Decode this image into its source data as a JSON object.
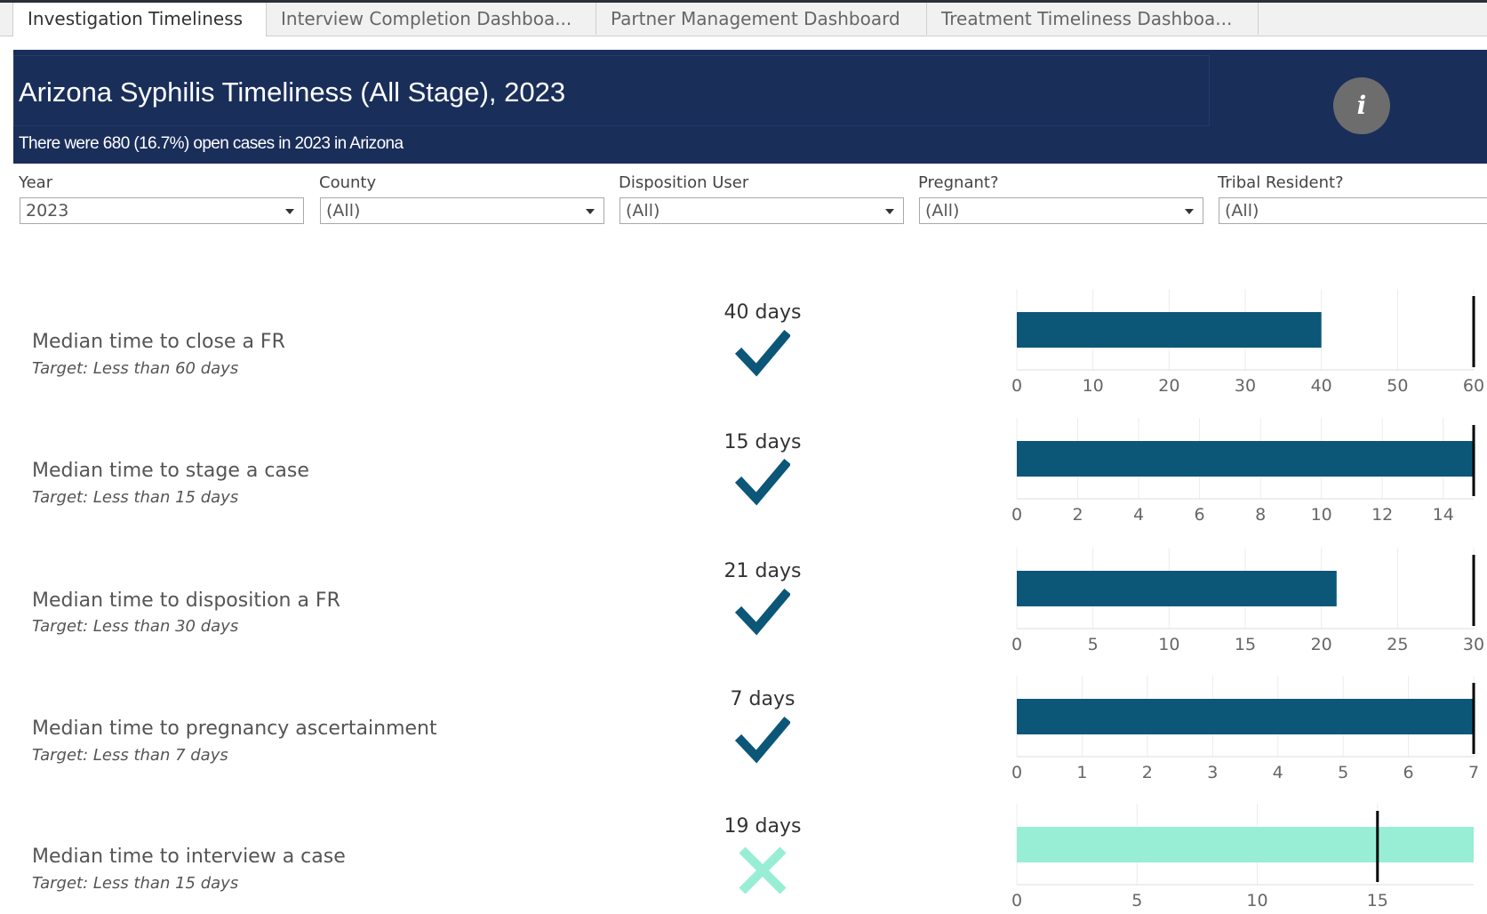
{
  "tabs": [
    {
      "label": "Investigation Timeliness",
      "active": true
    },
    {
      "label": "Interview Completion Dashboa...",
      "active": false
    },
    {
      "label": "Partner Management Dashboard",
      "active": false
    },
    {
      "label": "Treatment Timeliness Dashboa...",
      "active": false
    }
  ],
  "header": {
    "title": "Arizona Syphilis Timeliness (All Stage),  2023",
    "subtitle": "There were 680 (16.7%) open cases in 2023 in Arizona",
    "info_icon": "i",
    "background": "#1a2e5a"
  },
  "filters": [
    {
      "label": "Year",
      "value": "2023"
    },
    {
      "label": "County",
      "value": "(All)"
    },
    {
      "label": "Disposition User",
      "value": "(All)"
    },
    {
      "label": "Pregnant?",
      "value": "(All)"
    },
    {
      "label": "Tribal Resident?",
      "value": "(All)"
    }
  ],
  "colors": {
    "met": "#0c5678",
    "not_met": "#98eed4",
    "target_line": "#000000",
    "axis_text": "#666666"
  },
  "metrics": [
    {
      "label": "Median time to close a FR",
      "target_text": "Target: Less than 60 days",
      "value_text": "40 days",
      "status_icon": "check-icon"
    },
    {
      "label": "Median time to stage a case",
      "target_text": "Target: Less than 15 days",
      "value_text": "15 days",
      "status_icon": "check-icon"
    },
    {
      "label": "Median time to disposition a FR",
      "target_text": "Target: Less than 30 days",
      "value_text": "21 days",
      "status_icon": "check-icon"
    },
    {
      "label": "Median time to pregnancy ascertainment",
      "target_text": "Target: Less than 7 days",
      "value_text": "7 days",
      "status_icon": "check-icon"
    },
    {
      "label": "Median time to interview a case",
      "target_text": "Target: Less than 15 days",
      "value_text": "19 days",
      "status_icon": "x-icon"
    }
  ],
  "chart_data": [
    {
      "type": "bar",
      "title": "",
      "series": [
        {
          "values": [
            40
          ]
        }
      ],
      "target": 60,
      "xlim": [
        0,
        60
      ],
      "ticks": [
        0,
        10,
        20,
        30,
        40,
        50,
        60
      ],
      "met": true
    },
    {
      "type": "bar",
      "title": "",
      "series": [
        {
          "values": [
            15
          ]
        }
      ],
      "target": 15,
      "xlim": [
        0,
        15
      ],
      "ticks": [
        0,
        2,
        4,
        6,
        8,
        10,
        12,
        14
      ],
      "met": true
    },
    {
      "type": "bar",
      "title": "",
      "series": [
        {
          "values": [
            21
          ]
        }
      ],
      "target": 30,
      "xlim": [
        0,
        30
      ],
      "ticks": [
        0,
        5,
        10,
        15,
        20,
        25,
        30
      ],
      "met": true
    },
    {
      "type": "bar",
      "title": "",
      "series": [
        {
          "values": [
            7
          ]
        }
      ],
      "target": 7,
      "xlim": [
        0,
        7
      ],
      "ticks": [
        0,
        1,
        2,
        3,
        4,
        5,
        6,
        7
      ],
      "met": true
    },
    {
      "type": "bar",
      "title": "",
      "series": [
        {
          "values": [
            19
          ]
        }
      ],
      "target": 15,
      "xlim": [
        0,
        19
      ],
      "ticks": [
        0,
        5,
        10,
        15
      ],
      "met": false
    }
  ]
}
